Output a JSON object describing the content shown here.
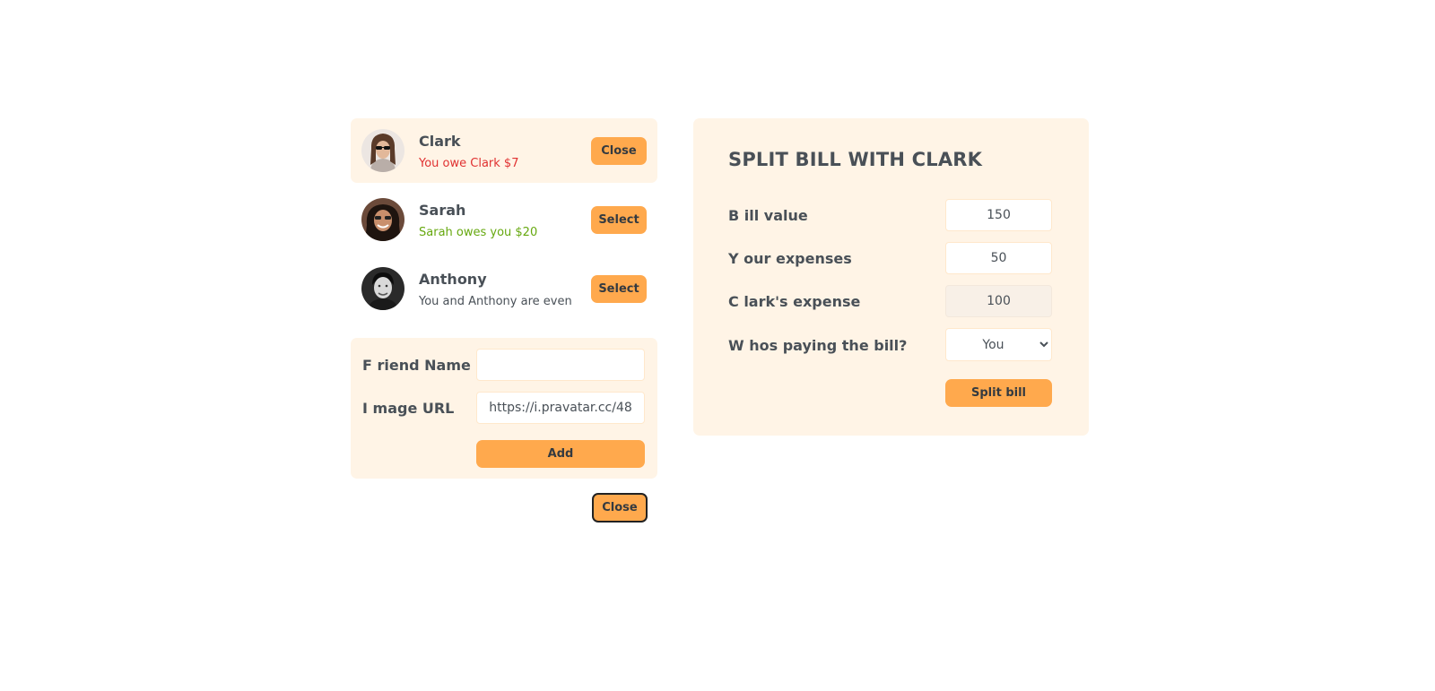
{
  "friends": [
    {
      "name": "Clark",
      "status": "You owe Clark $7",
      "button": "Close"
    },
    {
      "name": "Sarah",
      "status": "Sarah owes you $20",
      "button": "Select"
    },
    {
      "name": "Anthony",
      "status": "You and Anthony are even",
      "button": "Select"
    }
  ],
  "add_friend": {
    "name_label": "F riend Name",
    "name_value": "",
    "image_label": "I mage URL",
    "image_value": "https://i.pravatar.cc/48",
    "add_button": "Add"
  },
  "close_form_button": "Close",
  "split": {
    "title": "SPLIT BILL WITH CLARK",
    "bill_label": "B ill value",
    "bill_value": "150",
    "expense_label": "Y our expenses",
    "expense_value": "50",
    "friend_expense_label": "C lark's expense",
    "friend_expense_value": "100",
    "payer_label": "W hos paying the bill?",
    "payer_value": "You",
    "split_button": "Split bill"
  },
  "colors": {
    "accent": "#ffa94d",
    "panel": "#fff4e6",
    "owe": "#e03131",
    "owed": "#66a80f"
  }
}
